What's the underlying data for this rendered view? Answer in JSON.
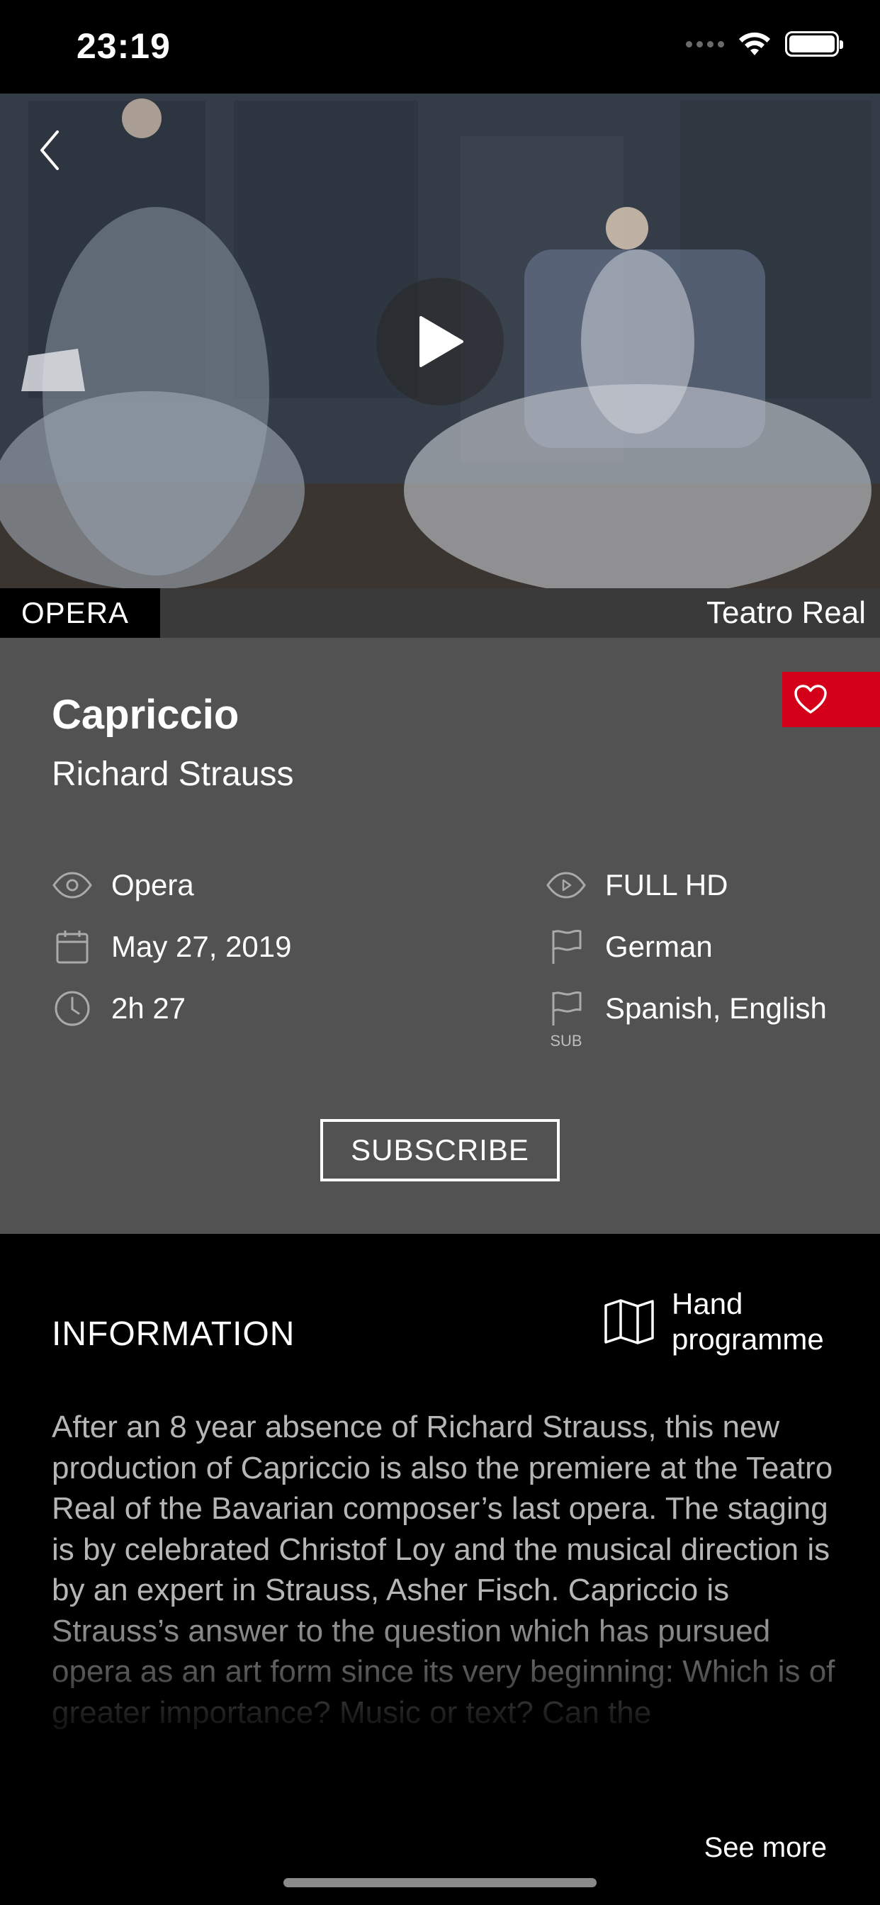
{
  "status_bar": {
    "time": "23:19"
  },
  "hero": {
    "category": "OPERA",
    "venue": "Teatro Real"
  },
  "details": {
    "title": "Capriccio",
    "composer": "Richard Strauss",
    "genre": "Opera",
    "date": "May 27, 2019",
    "duration": "2h 27",
    "quality": "FULL HD",
    "audio_language": "German",
    "subtitles": "Spanish, English",
    "subtitles_badge": "SUB",
    "subscribe_label": "SUBSCRIBE"
  },
  "information": {
    "heading": "INFORMATION",
    "hand_programme_label_line1": "Hand",
    "hand_programme_label_line2": "programme",
    "text": "After an 8 year absence of Richard Strauss, this new production of Capriccio is also the premiere at the Teatro Real of the Bavarian composer’s last opera. The staging is by celebrated Christof Loy and the musical direction is by an expert in Strauss, Asher Fisch. Capriccio is Strauss’s answer to the question which has pursued opera as an art form since its very beginning: Which is of greater importance? Music or text? Can the",
    "see_more": "See more"
  },
  "colors": {
    "accent": "#d4001a",
    "panel": "#525252",
    "background": "#000000"
  }
}
